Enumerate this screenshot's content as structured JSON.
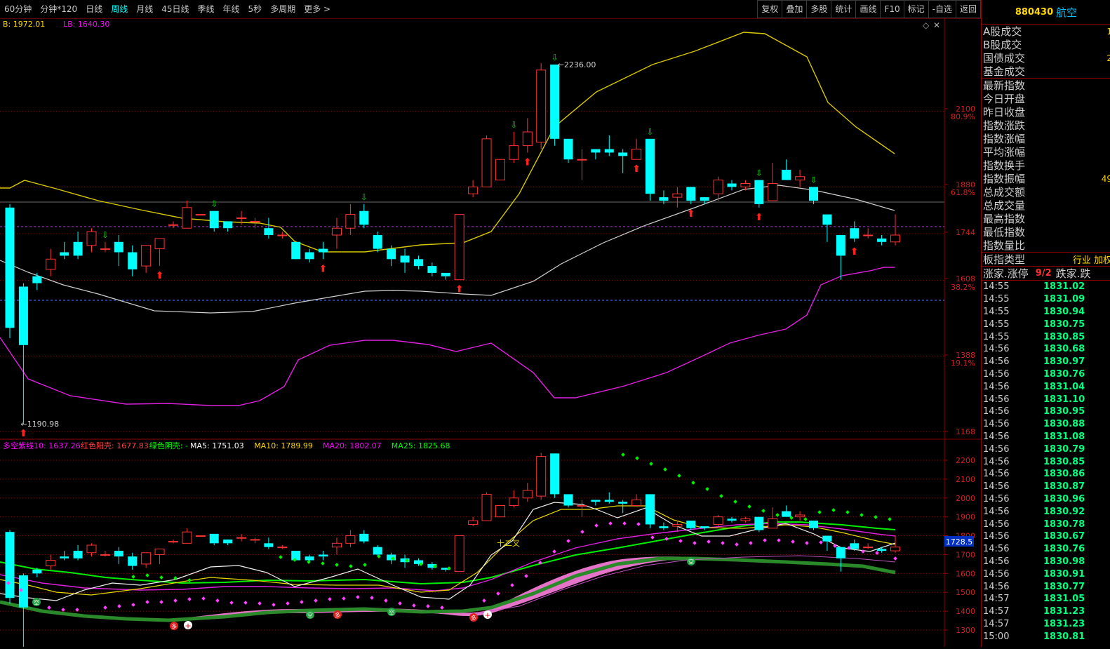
{
  "toolbar": {
    "periods": [
      "60分钟",
      "分钟*120",
      "日线",
      "周线",
      "月线",
      "45日线",
      "季线",
      "年线",
      "5秒",
      "多周期",
      "更多 >"
    ],
    "active_period": "周线",
    "tools": [
      "复权",
      "叠加",
      "多股",
      "统计",
      "画线",
      "F10",
      "标记",
      "-自选",
      "返回"
    ]
  },
  "main_panel": {
    "legend": [
      {
        "text": "B: 1972.01",
        "color": "#ffd700"
      },
      {
        "text": "LB: 1640.30",
        "color": "#ff00ff"
      }
    ],
    "price_axis": [
      "2100",
      "1880",
      "1744",
      "1608",
      "1388",
      "1168"
    ],
    "pct_axis": [
      "80.9%",
      "61.8%",
      "38.2%",
      "19.1%"
    ],
    "high_marker": "2236.00",
    "low_marker": "1190.98",
    "icons": [
      "diamond-icon",
      "close-icon"
    ]
  },
  "sub_panel": {
    "legend": [
      {
        "text": "多空紫线10: 1637.26",
        "color": "#ff00ff"
      },
      {
        "text": "红色阳壳: 1677.83",
        "color": "#ff4040"
      },
      {
        "text": "绿色阴壳: -",
        "color": "#00ff00"
      },
      {
        "text": "MA5: 1751.03",
        "color": "#ffffff"
      },
      {
        "text": "MA10: 1789.99",
        "color": "#ffd700"
      },
      {
        "text": "MA20: 1802.07",
        "color": "#ff00ff"
      },
      {
        "text": "MA25: 1825.68",
        "color": "#00ff00"
      }
    ],
    "price_axis": [
      "2200",
      "2100",
      "2000",
      "1900",
      "1800",
      "1700",
      "1600",
      "1500",
      "1400",
      "1300"
    ],
    "current_tag": "1728.5",
    "cross_label": "十二叉"
  },
  "sidebar": {
    "code": "880430",
    "name": "航空",
    "stats_top": [
      {
        "label": "A股成交",
        "value": "1"
      },
      {
        "label": "B股成交",
        "value": ""
      },
      {
        "label": "国债成交",
        "value": "2"
      },
      {
        "label": "基金成交",
        "value": ""
      }
    ],
    "stats_mid": [
      {
        "label": "最新指数",
        "value": ""
      },
      {
        "label": "今日开盘",
        "value": ""
      },
      {
        "label": "昨日收盘",
        "value": ""
      },
      {
        "label": "指数涨跌",
        "value": ""
      },
      {
        "label": "指数涨幅",
        "value": ""
      },
      {
        "label": "平均涨幅",
        "value": ""
      },
      {
        "label": "指数换手",
        "value": ""
      },
      {
        "label": "指数振幅",
        "value": "49"
      },
      {
        "label": "总成交额",
        "value": ""
      },
      {
        "label": "总成交量",
        "value": ""
      },
      {
        "label": "最高指数",
        "value": ""
      },
      {
        "label": "最低指数",
        "value": ""
      },
      {
        "label": "指数量比",
        "value": ""
      }
    ],
    "board_type": {
      "label": "板指类型",
      "value": "行业 加权"
    },
    "limit_row": {
      "label": "涨家.涨停",
      "value": "9/2",
      "label2": "跌家.跌"
    },
    "ticks": [
      [
        "14:55",
        "1831.02"
      ],
      [
        "14:55",
        "1831.09"
      ],
      [
        "14:55",
        "1830.94"
      ],
      [
        "14:55",
        "1830.75"
      ],
      [
        "14:55",
        "1830.85"
      ],
      [
        "14:56",
        "1830.68"
      ],
      [
        "14:56",
        "1830.97"
      ],
      [
        "14:56",
        "1830.76"
      ],
      [
        "14:56",
        "1831.04"
      ],
      [
        "14:56",
        "1831.10"
      ],
      [
        "14:56",
        "1830.95"
      ],
      [
        "14:56",
        "1830.88"
      ],
      [
        "14:56",
        "1831.08"
      ],
      [
        "14:56",
        "1830.79"
      ],
      [
        "14:56",
        "1830.85"
      ],
      [
        "14:56",
        "1830.86"
      ],
      [
        "14:56",
        "1830.87"
      ],
      [
        "14:56",
        "1830.96"
      ],
      [
        "14:56",
        "1830.92"
      ],
      [
        "14:56",
        "1830.78"
      ],
      [
        "14:56",
        "1830.67"
      ],
      [
        "14:56",
        "1830.76"
      ],
      [
        "14:56",
        "1830.98"
      ],
      [
        "14:56",
        "1830.91"
      ],
      [
        "14:56",
        "1830.77"
      ],
      [
        "14:57",
        "1831.05"
      ],
      [
        "14:57",
        "1831.23"
      ],
      [
        "14:57",
        "1831.23"
      ],
      [
        "15:00",
        "1830.81"
      ]
    ]
  },
  "chart_data": {
    "type": "candlestick",
    "candles": [
      [
        1820,
        1470,
        1830,
        1440
      ],
      [
        1590,
        1420,
        1600,
        1190.98
      ],
      [
        1620,
        1600,
        1630,
        1580
      ],
      [
        1640,
        1670,
        1700,
        1620
      ],
      [
        1690,
        1680,
        1720,
        1670
      ],
      [
        1720,
        1680,
        1750,
        1670
      ],
      [
        1710,
        1750,
        1760,
        1690
      ],
      [
        1700,
        1700,
        1720,
        1690
      ],
      [
        1720,
        1690,
        1740,
        1650
      ],
      [
        1690,
        1640,
        1710,
        1620
      ],
      [
        1650,
        1710,
        1710,
        1630
      ],
      [
        1700,
        1730,
        1730,
        1650
      ],
      [
        1770,
        1770,
        1780,
        1760
      ],
      [
        1760,
        1820,
        1840,
        1760
      ],
      [
        1800,
        1800,
        1800,
        1800
      ],
      [
        1810,
        1760,
        1810,
        1750
      ],
      [
        1780,
        1760,
        1780,
        1750
      ],
      [
        1790,
        1790,
        1810,
        1770
      ],
      [
        1780,
        1780,
        1790,
        1760
      ],
      [
        1760,
        1740,
        1790,
        1730
      ],
      [
        1740,
        1740,
        1750,
        1730
      ],
      [
        1720,
        1670,
        1720,
        1670
      ],
      [
        1690,
        1670,
        1700,
        1660
      ],
      [
        1700,
        1690,
        1720,
        1670
      ],
      [
        1740,
        1760,
        1790,
        1700
      ],
      [
        1760,
        1800,
        1830,
        1740
      ],
      [
        1810,
        1770,
        1830,
        1760
      ],
      [
        1740,
        1700,
        1750,
        1690
      ],
      [
        1700,
        1670,
        1710,
        1650
      ],
      [
        1680,
        1660,
        1700,
        1630
      ],
      [
        1670,
        1650,
        1680,
        1640
      ],
      [
        1650,
        1630,
        1660,
        1620
      ],
      [
        1630,
        1620,
        1630,
        1610
      ],
      [
        1610,
        1800,
        1800,
        1610
      ],
      [
        1860,
        1880,
        1900,
        1850
      ],
      [
        1880,
        2020,
        2030,
        1880
      ],
      [
        1900,
        1960,
        1960,
        1900
      ],
      [
        1960,
        2000,
        2040,
        1950
      ],
      [
        2000,
        2040,
        2080,
        1980
      ],
      [
        2010,
        2220,
        2240,
        1990
      ],
      [
        2236,
        2020,
        2236,
        2000
      ],
      [
        2020,
        1960,
        2020,
        1950
      ],
      [
        1960,
        1960,
        1990,
        1900
      ],
      [
        1990,
        1980,
        1990,
        1960
      ],
      [
        1990,
        1980,
        2030,
        1970
      ],
      [
        1980,
        1970,
        1990,
        1920
      ],
      [
        1960,
        1990,
        2020,
        1960
      ],
      [
        2020,
        1860,
        2020,
        1840
      ],
      [
        1850,
        1840,
        1870,
        1830
      ],
      [
        1850,
        1860,
        1880,
        1820
      ],
      [
        1880,
        1840,
        1880,
        1830
      ],
      [
        1850,
        1840,
        1850,
        1830
      ],
      [
        1860,
        1900,
        1910,
        1840
      ],
      [
        1890,
        1880,
        1900,
        1870
      ],
      [
        1880,
        1890,
        1900,
        1870
      ],
      [
        1900,
        1830,
        1900,
        1820
      ],
      [
        1840,
        1890,
        1950,
        1840
      ],
      [
        1930,
        1900,
        1960,
        1900
      ],
      [
        1900,
        1910,
        1930,
        1880
      ],
      [
        1880,
        1840,
        1880,
        1830
      ],
      [
        1800,
        1770,
        1800,
        1720
      ],
      [
        1740,
        1680,
        1740,
        1610
      ],
      [
        1760,
        1730,
        1780,
        1720
      ],
      [
        1740,
        1740,
        1760,
        1730
      ],
      [
        1730,
        1720,
        1740,
        1710
      ],
      [
        1720,
        1740,
        1800,
        1710
      ]
    ]
  }
}
